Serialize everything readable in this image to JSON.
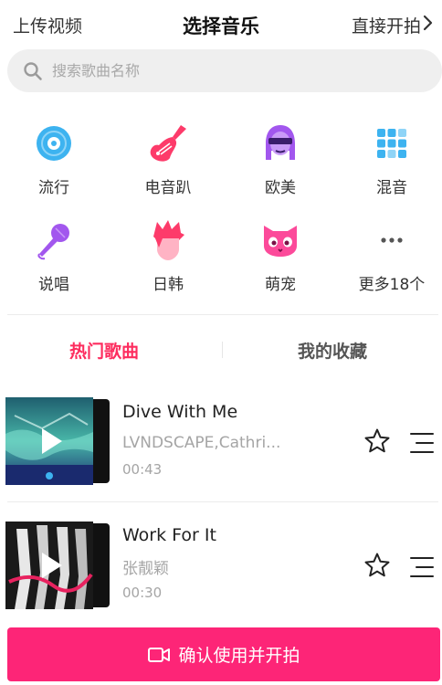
{
  "header": {
    "left_label": "上传视频",
    "title": "选择音乐",
    "right_label": "直接开拍"
  },
  "search": {
    "placeholder": "搜索歌曲名称"
  },
  "categories": [
    {
      "label": "流行",
      "icon": "vinyl-record-icon",
      "color": "#3db3f0"
    },
    {
      "label": "电音趴",
      "icon": "electric-guitar-icon",
      "color": "#fd3b6a"
    },
    {
      "label": "欧美",
      "icon": "person-sunglasses-icon",
      "color": "#a257ee"
    },
    {
      "label": "混音",
      "icon": "mixer-grid-icon",
      "color": "#3db3f0"
    },
    {
      "label": "说唱",
      "icon": "microphone-icon",
      "color": "#a257ee"
    },
    {
      "label": "日韩",
      "icon": "spiky-hair-person-icon",
      "color": "#fd3b6a"
    },
    {
      "label": "萌宠",
      "icon": "cat-face-icon",
      "color": "#fc4a9a"
    },
    {
      "label": "更多18个",
      "icon": "more-dots-icon",
      "color": "#555555"
    }
  ],
  "tabs": {
    "hot": "热门歌曲",
    "favorites": "我的收藏"
  },
  "songs": [
    {
      "title": "Dive With Me",
      "artist": "LVNDSCAPE,Cathri...",
      "duration": "00:43"
    },
    {
      "title": "Work For It",
      "artist": "张靓颖",
      "duration": "00:30"
    }
  ],
  "confirm_button": {
    "label": "确认使用并开拍"
  },
  "colors": {
    "accent": "#fd2c5e",
    "confirm_bg": "#fd2577",
    "search_bg": "#efefef"
  }
}
